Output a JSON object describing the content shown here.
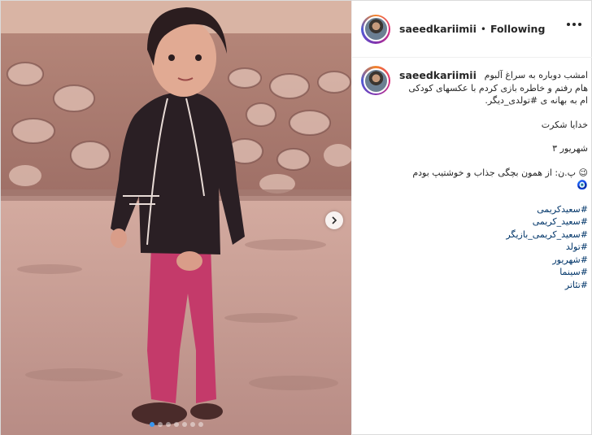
{
  "post": {
    "author": "saeedkariimii",
    "follow_status": "Following",
    "separator": "•"
  },
  "carousel": {
    "slide_count": 7,
    "active_index": 0
  },
  "caption": {
    "username": "saeedkariimii",
    "line1": "امشب دوباره به سراغ آلبوم",
    "line2": "هام رفتم و خاطره بازی کردم با عکسهای کودکی",
    "line3": "ام به بهانه ی #تولدی_دیگر.",
    "line4": "خدایا شکرت",
    "line5": "شهریور ۳",
    "line6": "😉 پ.ن: از همون بچگی جذاب و خوشتیپ بودم",
    "line7": "🧿",
    "hashtags": [
      "#سعیدکریمی",
      "#سعید_کریمی",
      "#سعید_کریمی_بازیگر",
      "#تولد",
      "#شهریور",
      "#سینما",
      "#تئاتر"
    ]
  },
  "icons": {
    "next": "chevron-right-icon",
    "more": "more-horizontal-icon"
  },
  "colors": {
    "accent": "#3897f0",
    "hashtag": "#003569",
    "text": "#262626"
  }
}
